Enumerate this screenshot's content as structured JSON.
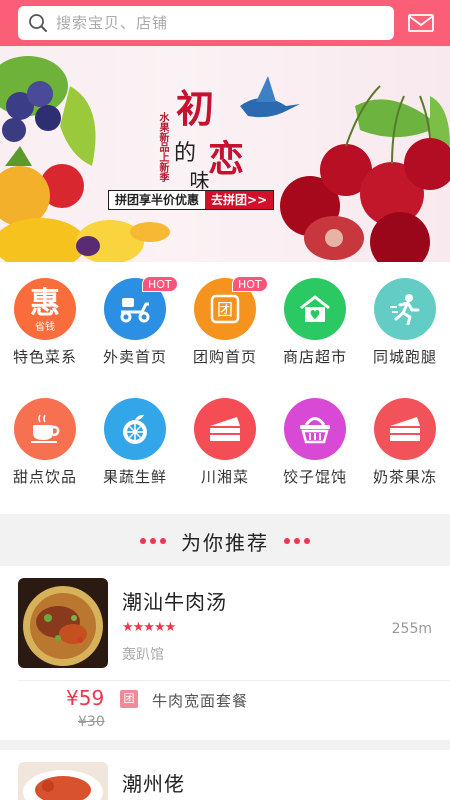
{
  "header": {
    "search_placeholder": "搜索宝贝、店铺",
    "mail_icon": "mail-icon",
    "color": "#fb5f78"
  },
  "banner": {
    "side_tag": "水果新品上新季",
    "title_1": "初",
    "title_2": "的",
    "title_3": "恋",
    "title_4": "味道",
    "promo_text": "拼团享半价优惠",
    "promo_button": "去拼团>>"
  },
  "categories": [
    {
      "label": "特色菜系",
      "icon": "hui-icon",
      "color": "#f96d3c",
      "hot": false,
      "sub": "省钱"
    },
    {
      "label": "外卖首页",
      "icon": "scooter-icon",
      "color": "#2b8fe3",
      "hot": true,
      "badge": "HOT"
    },
    {
      "label": "团购首页",
      "icon": "tuan-icon",
      "color": "#f6931f",
      "hot": true,
      "badge": "HOT"
    },
    {
      "label": "商店超市",
      "icon": "store-icon",
      "color": "#2bc964",
      "hot": false
    },
    {
      "label": "同城跑腿",
      "icon": "runner-icon",
      "color": "#63cdc5",
      "hot": false
    },
    {
      "label": "甜点饮品",
      "icon": "coffee-icon",
      "color": "#f7704f",
      "hot": false
    },
    {
      "label": "果蔬生鲜",
      "icon": "fruit-icon",
      "color": "#33a6ea",
      "hot": false
    },
    {
      "label": "川湘菜",
      "icon": "cake-icon",
      "color": "#f54d55",
      "hot": false
    },
    {
      "label": "饺子馄饨",
      "icon": "basket-icon",
      "color": "#d84ad6",
      "hot": false
    },
    {
      "label": "奶茶果冻",
      "icon": "cake-slice-icon",
      "color": "#f2535a",
      "hot": false
    }
  ],
  "recommend": {
    "title": "为你推荐"
  },
  "shops": [
    {
      "name": "潮汕牛肉汤",
      "rating": 5,
      "distance": "255m",
      "sub": "轰趴馆",
      "price": "¥59",
      "old_price": "¥30",
      "tag": "团",
      "deal": "牛肉宽面套餐"
    },
    {
      "name": "潮州佬"
    }
  ]
}
